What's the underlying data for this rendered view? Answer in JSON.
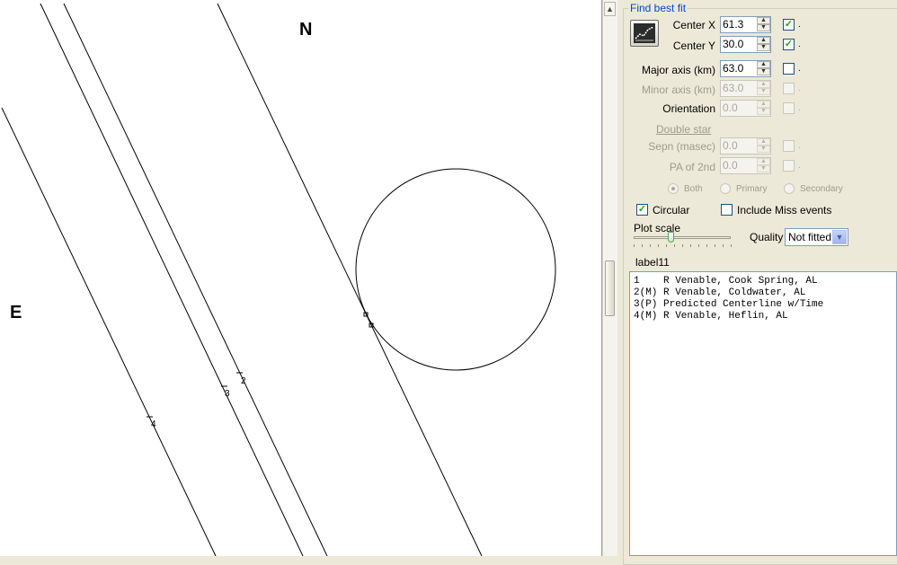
{
  "plot": {
    "north_label": "N",
    "east_label": "E",
    "chord_markers": [
      "1",
      "2",
      "3",
      "4"
    ]
  },
  "panel": {
    "group_title": "Find best fit",
    "fields": [
      {
        "label": "Center X",
        "value": "61.3",
        "enabled": true,
        "checked": true
      },
      {
        "label": "Center Y",
        "value": "30.0",
        "enabled": true,
        "checked": true
      },
      {
        "label": "Major axis (km)",
        "value": "63.0",
        "enabled": true,
        "checked": false
      },
      {
        "label": "Minor axis (km)",
        "value": "63.0",
        "enabled": false,
        "checked": false
      },
      {
        "label": "Orientation",
        "value": "0.0",
        "enabled": false,
        "checked": false
      }
    ],
    "double_star": {
      "title": "Double star",
      "fields": [
        {
          "label": "Sepn (masec)",
          "value": "0.0",
          "enabled": false,
          "checked": false
        },
        {
          "label": "PA of 2nd",
          "value": "0.0",
          "enabled": false,
          "checked": false
        }
      ],
      "radios": [
        {
          "label": "Both",
          "selected": true
        },
        {
          "label": "Primary",
          "selected": false
        },
        {
          "label": "Secondary",
          "selected": false
        }
      ]
    },
    "checkbox_dot": ".",
    "circular": {
      "label": "Circular",
      "checked": true
    },
    "include_miss": {
      "label": "Include Miss events",
      "checked": false
    },
    "plot_scale_label": "Plot scale",
    "plot_scale_level": 0.38,
    "quality_label": "Quality",
    "quality_value": "Not fitted",
    "list_label": "label11",
    "list_rows": [
      "1    R Venable, Cook Spring, AL",
      "2(M) R Venable, Coldwater, AL",
      "3(P) Predicted Centerline w/Time",
      "4(M) R Venable, Heflin, AL"
    ]
  }
}
